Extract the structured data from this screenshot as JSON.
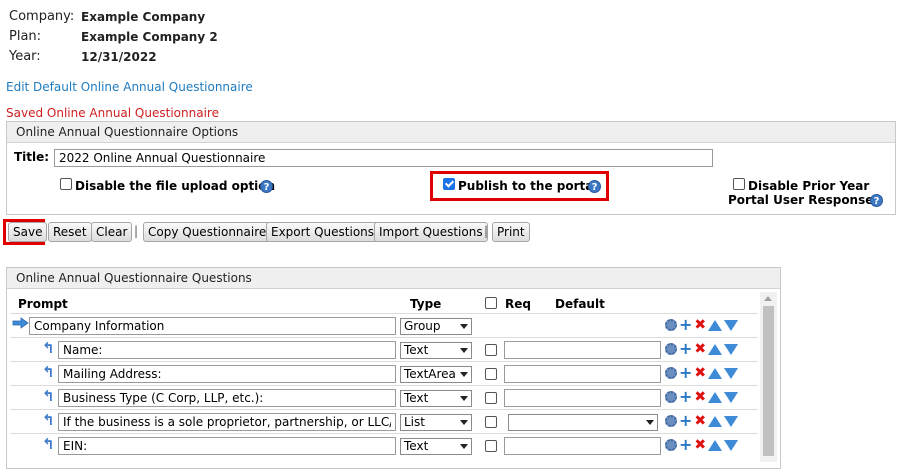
{
  "info": {
    "company_label": "Company:",
    "company_value": "Example Company",
    "plan_label": "Plan:",
    "plan_value": "Example Company 2",
    "year_label": "Year:",
    "year_value": "12/31/2022"
  },
  "edit_link": "Edit Default Online Annual Questionnaire",
  "saved_message": "Saved Online Annual Questionnaire",
  "options": {
    "header": "Online Annual Questionnaire Options",
    "title_label": "Title:",
    "title_value": "2022 Online Annual Questionnaire",
    "disable_upload_label": "Disable the file upload option",
    "disable_upload_checked": false,
    "publish_label": "Publish to the portal",
    "publish_checked": true,
    "disable_prior_line1": "Disable Prior Year",
    "disable_prior_line2": "Portal User Responses",
    "disable_prior_checked": false
  },
  "toolbar": {
    "save": "Save",
    "reset": "Reset",
    "clear": "Clear",
    "copy": "Copy Questionnaire",
    "export": "Export Questions",
    "import": "Import Questions",
    "print": "Print",
    "separator": "|"
  },
  "questions": {
    "header": "Online Annual Questionnaire Questions",
    "col_prompt": "Prompt",
    "col_type": "Type",
    "col_req": "Req",
    "col_default": "Default",
    "rows": [
      {
        "prompt": "Company Information",
        "type": "Group"
      },
      {
        "prompt": "Name:",
        "type": "Text"
      },
      {
        "prompt": "Mailing Address:",
        "type": "TextArea"
      },
      {
        "prompt": "Business Type (C Corp, LLP, etc.):",
        "type": "Text"
      },
      {
        "prompt": "If the business is a sole proprietor, partnership, or LLC/LLP,",
        "type": "List"
      },
      {
        "prompt": "EIN:",
        "type": "Text"
      }
    ]
  },
  "icons": {
    "help": "?",
    "help_icon": "question-circle-icon",
    "gear_icon": "gear-icon",
    "add_icon": "plus-icon",
    "delete_icon": "x-icon",
    "up_icon": "arrow-up-icon",
    "down_icon": "arrow-down-icon",
    "child_icon": "curved-back-arrow-icon",
    "group_icon": "right-arrow-icon",
    "plus": "+",
    "cross": "✖",
    "child_arrow": "↰"
  },
  "colors": {
    "link": "#1f7bbf",
    "saved": "#d02020",
    "highlight": "#e00000",
    "icon_blue": "#3d8ad6"
  }
}
